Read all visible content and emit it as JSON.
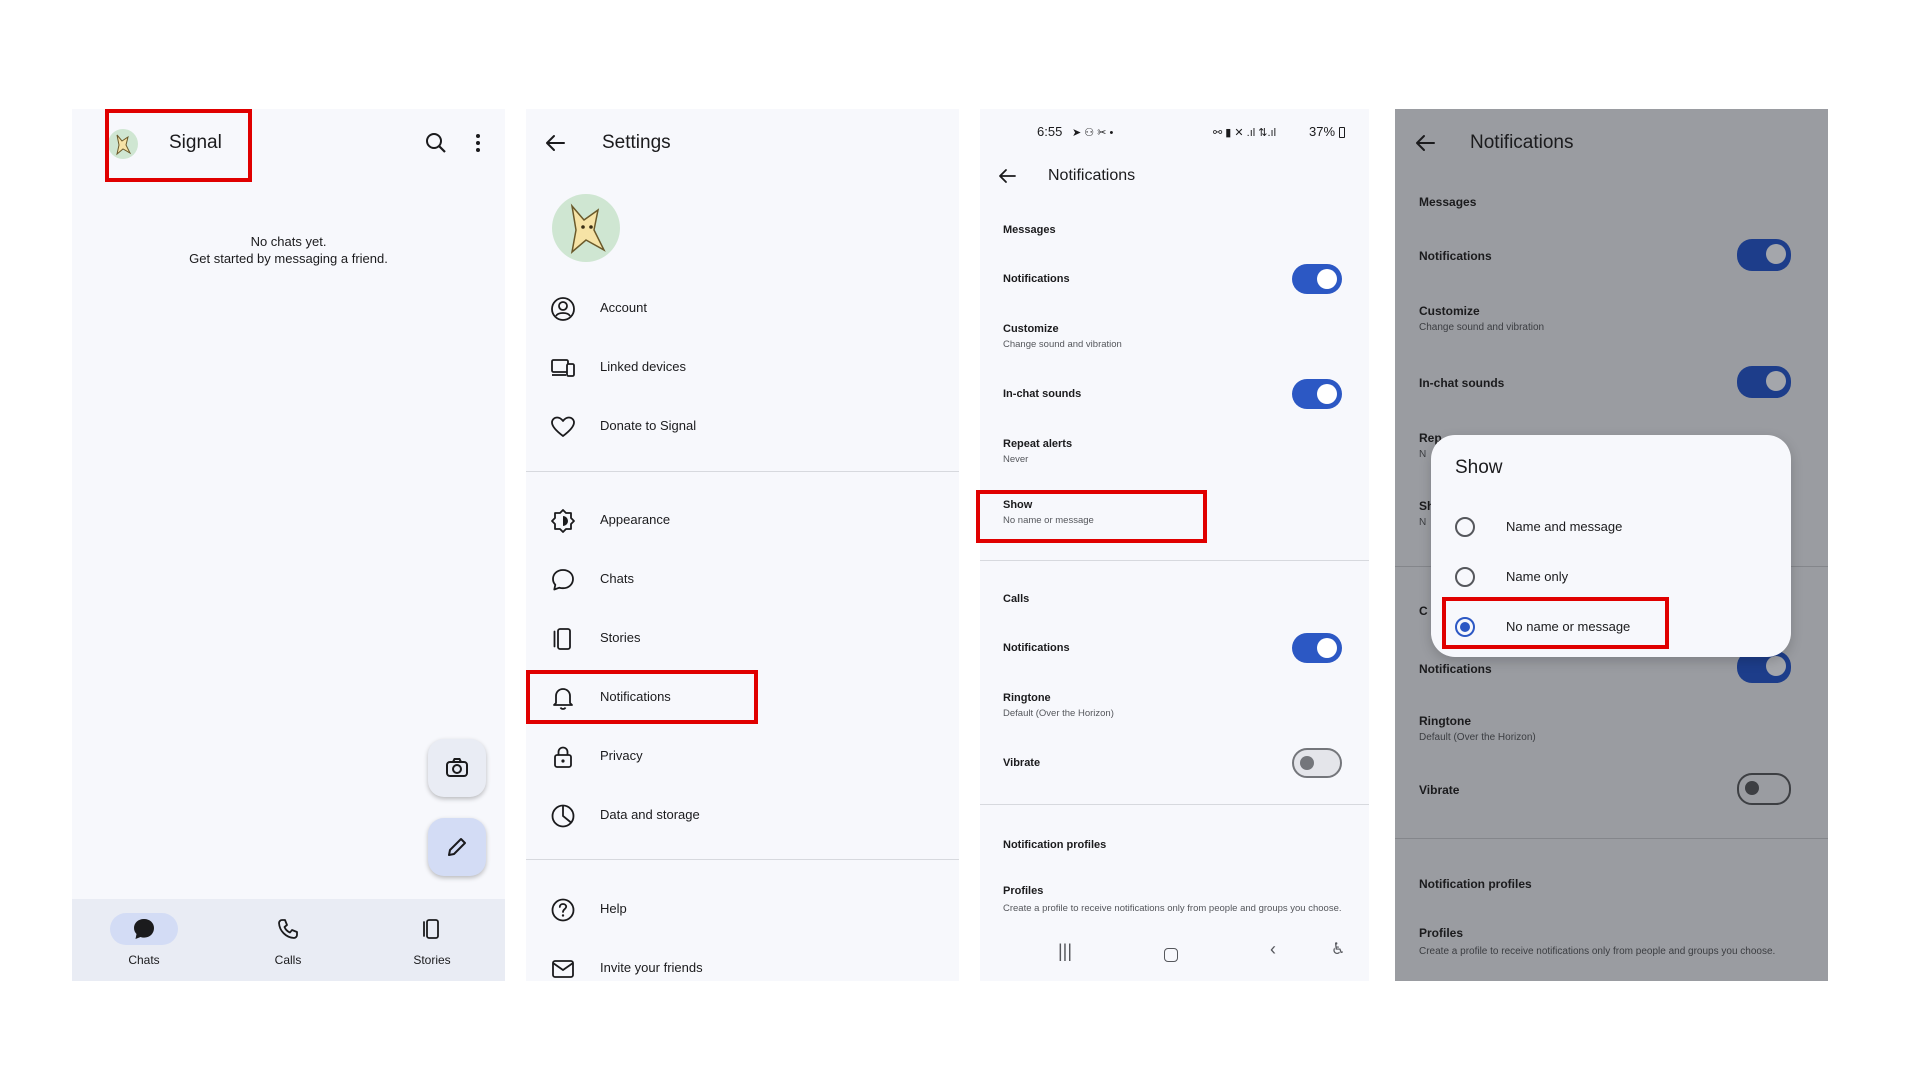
{
  "colors": {
    "accent": "#2c58c4",
    "highlight": "#e00000",
    "scrim": "#9a9ca1"
  },
  "panel1": {
    "app_title": "Signal",
    "empty_line1": "No chats yet.",
    "empty_line2": "Get started by messaging a friend.",
    "icons": [
      "search-icon",
      "more-vert-icon",
      "camera-icon",
      "pencil-icon"
    ],
    "nav": [
      {
        "label": "Chats",
        "icon": "chat-bubble-icon",
        "selected": true
      },
      {
        "label": "Calls",
        "icon": "phone-icon"
      },
      {
        "label": "Stories",
        "icon": "stories-icon"
      }
    ]
  },
  "panel2": {
    "title": "Settings",
    "items": [
      {
        "label": "Account",
        "icon": "account-icon"
      },
      {
        "label": "Linked devices",
        "icon": "linked-devices-icon"
      },
      {
        "label": "Donate to Signal",
        "icon": "heart-icon"
      },
      {
        "label": "Appearance",
        "icon": "appearance-icon"
      },
      {
        "label": "Chats",
        "icon": "chat-bubble-icon"
      },
      {
        "label": "Stories",
        "icon": "stories-icon"
      },
      {
        "label": "Notifications",
        "icon": "bell-icon"
      },
      {
        "label": "Privacy",
        "icon": "lock-icon"
      },
      {
        "label": "Data and storage",
        "icon": "pie-chart-icon"
      },
      {
        "label": "Help",
        "icon": "help-icon"
      },
      {
        "label": "Invite your friends",
        "icon": "mail-icon"
      }
    ]
  },
  "panel3": {
    "status_time": "6:55",
    "status_battery": "37%",
    "title": "Notifications",
    "messages_header": "Messages",
    "notifications": "Notifications",
    "customize": "Customize",
    "customize_sub": "Change sound and vibration",
    "in_chat_sounds": "In-chat sounds",
    "repeat_alerts": "Repeat alerts",
    "repeat_alerts_sub": "Never",
    "show": "Show",
    "show_sub": "No name or message",
    "calls_header": "Calls",
    "calls_notifications": "Notifications",
    "ringtone": "Ringtone",
    "ringtone_sub": "Default (Over the Horizon)",
    "vibrate": "Vibrate",
    "profiles_header": "Notification profiles",
    "profiles": "Profiles",
    "profiles_sub": "Create a profile to receive notifications only from people and groups you choose."
  },
  "panel4": {
    "title": "Notifications",
    "messages_header": "Messages",
    "notifications": "Notifications",
    "customize": "Customize",
    "customize_sub": "Change sound and vibration",
    "in_chat_sounds": "In-chat sounds",
    "partial_rep": "Rep",
    "partial_n1": "N",
    "partial_sh": "Sh",
    "partial_n2": "N",
    "partial_c": "C",
    "calls_notifications": "Notifications",
    "ringtone": "Ringtone",
    "ringtone_sub": "Default (Over the Horizon)",
    "vibrate": "Vibrate",
    "profiles_header": "Notification profiles",
    "profiles": "Profiles",
    "profiles_sub": "Create a profile to receive notifications only from people and groups you choose.",
    "dialog": {
      "title": "Show",
      "options": [
        "Name and message",
        "Name only",
        "No name or message"
      ],
      "selected": "No name or message"
    }
  }
}
